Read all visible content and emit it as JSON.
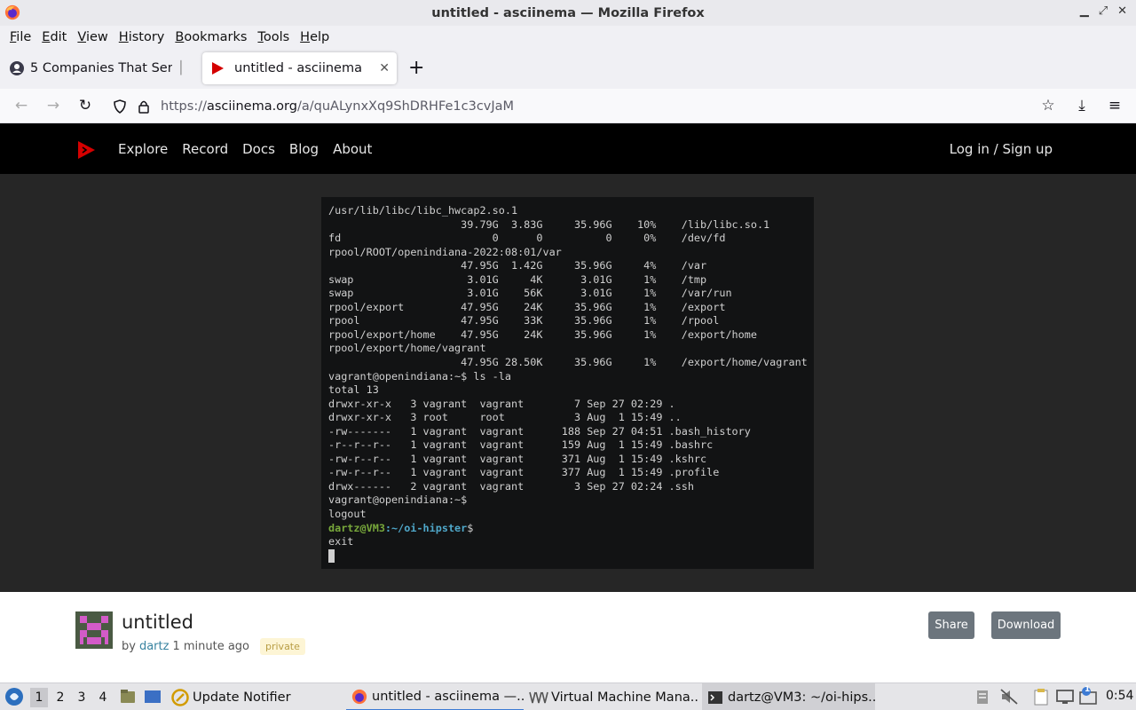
{
  "window": {
    "title": "untitled - asciinema — Mozilla Firefox"
  },
  "menu": [
    "File",
    "Edit",
    "View",
    "History",
    "Bookmarks",
    "Tools",
    "Help"
  ],
  "tabs": [
    {
      "label": "5 Companies That Send",
      "active": false
    },
    {
      "label": "untitled - asciinema",
      "active": true
    }
  ],
  "urlbar": {
    "prefix": "https://",
    "domain": "asciinema.org",
    "path": "/a/quALynxXq9ShDRHFe1c3cvJaM"
  },
  "site": {
    "nav": [
      "Explore",
      "Record",
      "Docs",
      "Blog",
      "About"
    ],
    "login": "Log in / Sign up"
  },
  "terminal": {
    "lines": [
      "/usr/lib/libc/libc_hwcap2.so.1",
      "                     39.79G  3.83G     35.96G    10%    /lib/libc.so.1",
      "fd                        0      0          0     0%    /dev/fd",
      "rpool/ROOT/openindiana-2022:08:01/var",
      "                     47.95G  1.42G     35.96G     4%    /var",
      "swap                  3.01G     4K      3.01G     1%    /tmp",
      "swap                  3.01G    56K      3.01G     1%    /var/run",
      "rpool/export         47.95G    24K     35.96G     1%    /export",
      "rpool                47.95G    33K     35.96G     1%    /rpool",
      "rpool/export/home    47.95G    24K     35.96G     1%    /export/home",
      "rpool/export/home/vagrant",
      "                     47.95G 28.50K     35.96G     1%    /export/home/vagrant",
      "vagrant@openindiana:~$ ls -la",
      "total 13",
      "drwxr-xr-x   3 vagrant  vagrant        7 Sep 27 02:29 .",
      "drwxr-xr-x   3 root     root           3 Aug  1 15:49 ..",
      "-rw-------   1 vagrant  vagrant      188 Sep 27 04:51 .bash_history",
      "-r--r--r--   1 vagrant  vagrant      159 Aug  1 15:49 .bashrc",
      "-rw-r--r--   1 vagrant  vagrant      371 Aug  1 15:49 .kshrc",
      "-rw-r--r--   1 vagrant  vagrant      377 Aug  1 15:49 .profile",
      "drwx------   2 vagrant  vagrant        3 Sep 27 02:24 .ssh",
      "vagrant@openindiana:~$",
      "logout"
    ],
    "prompt_user": "dartz@VM3",
    "prompt_path": ":~/oi-hipster",
    "prompt_end": "$",
    "last_command": "exit"
  },
  "recording": {
    "title": "untitled",
    "by": "by",
    "author": "dartz",
    "time": "1 minute ago",
    "badge": "private",
    "share": "Share",
    "download": "Download"
  },
  "taskbar": {
    "workspaces": [
      "1",
      "2",
      "3",
      "4"
    ],
    "items": [
      "Update Notifier",
      "untitled - asciinema —...",
      "Virtual Machine Mana...",
      "dartz@VM3: ~/oi-hips..."
    ],
    "clock": "0:54",
    "notify_count": "1"
  }
}
